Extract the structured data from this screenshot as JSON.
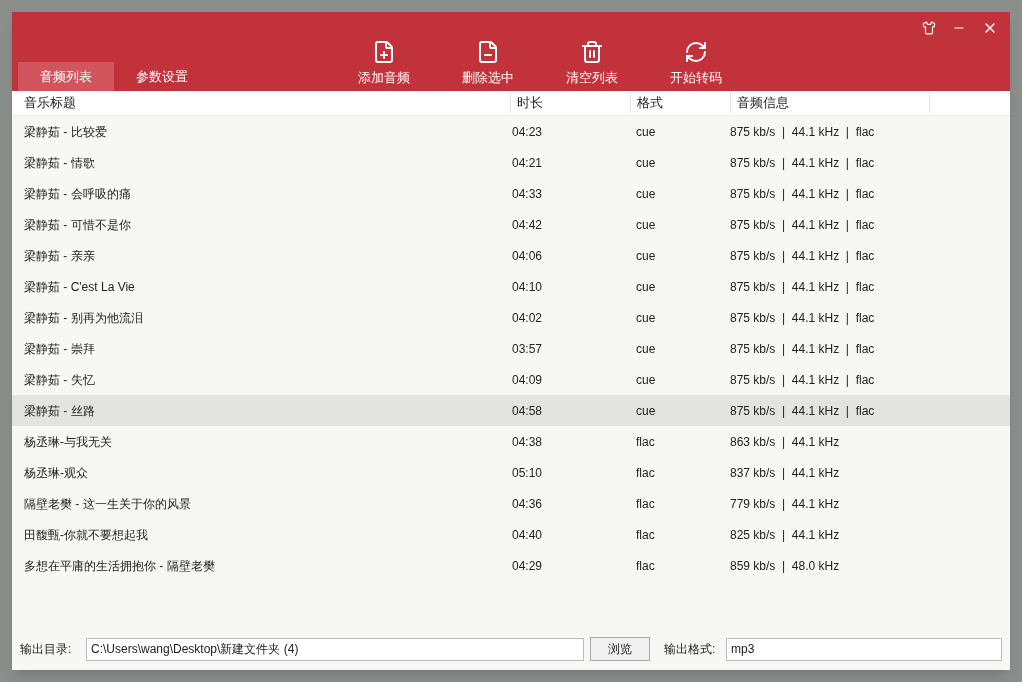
{
  "tabs": [
    {
      "label": "音频列表",
      "selected": true
    },
    {
      "label": "参数设置",
      "selected": false
    }
  ],
  "toolbar": [
    {
      "kind": "add",
      "label": "添加音频"
    },
    {
      "kind": "remove",
      "label": "删除选中"
    },
    {
      "kind": "clear",
      "label": "清空列表"
    },
    {
      "kind": "convert",
      "label": "开始转码"
    }
  ],
  "table": {
    "columns": [
      "音乐标题",
      "时长",
      "格式",
      "音频信息"
    ],
    "rows": [
      {
        "title": "梁静茹 - 比较爱",
        "duration": "04:23",
        "format": "cue",
        "info": "875 kb/s  |  44.1 kHz  |  flac",
        "selected": false
      },
      {
        "title": "梁静茹 - 情歌",
        "duration": "04:21",
        "format": "cue",
        "info": "875 kb/s  |  44.1 kHz  |  flac",
        "selected": false
      },
      {
        "title": "梁静茹 - 会呼吸的痛",
        "duration": "04:33",
        "format": "cue",
        "info": "875 kb/s  |  44.1 kHz  |  flac",
        "selected": false
      },
      {
        "title": "梁静茹 - 可惜不是你",
        "duration": "04:42",
        "format": "cue",
        "info": "875 kb/s  |  44.1 kHz  |  flac",
        "selected": false
      },
      {
        "title": "梁静茹 - 亲亲",
        "duration": "04:06",
        "format": "cue",
        "info": "875 kb/s  |  44.1 kHz  |  flac",
        "selected": false
      },
      {
        "title": "梁静茹 - C'est La Vie",
        "duration": "04:10",
        "format": "cue",
        "info": "875 kb/s  |  44.1 kHz  |  flac",
        "selected": false
      },
      {
        "title": "梁静茹 - 别再为他流泪",
        "duration": "04:02",
        "format": "cue",
        "info": "875 kb/s  |  44.1 kHz  |  flac",
        "selected": false
      },
      {
        "title": "梁静茹 - 崇拜",
        "duration": "03:57",
        "format": "cue",
        "info": "875 kb/s  |  44.1 kHz  |  flac",
        "selected": false
      },
      {
        "title": "梁静茹 - 失忆",
        "duration": "04:09",
        "format": "cue",
        "info": "875 kb/s  |  44.1 kHz  |  flac",
        "selected": false
      },
      {
        "title": "梁静茹 - 丝路",
        "duration": "04:58",
        "format": "cue",
        "info": "875 kb/s  |  44.1 kHz  |  flac",
        "selected": true
      },
      {
        "title": "杨丞琳-与我无关",
        "duration": "04:38",
        "format": "flac",
        "info": "863 kb/s  |  44.1 kHz",
        "selected": false
      },
      {
        "title": "杨丞琳-观众",
        "duration": "05:10",
        "format": "flac",
        "info": "837 kb/s  |  44.1 kHz",
        "selected": false
      },
      {
        "title": "隔壁老樊 - 这一生关于你的风景",
        "duration": "04:36",
        "format": "flac",
        "info": "779 kb/s  |  44.1 kHz",
        "selected": false
      },
      {
        "title": "田馥甄-你就不要想起我",
        "duration": "04:40",
        "format": "flac",
        "info": "825 kb/s  |  44.1 kHz",
        "selected": false
      },
      {
        "title": "多想在平庸的生活拥抱你 - 隔壁老樊",
        "duration": "04:29",
        "format": "flac",
        "info": "859 kb/s  |  48.0 kHz",
        "selected": false
      }
    ]
  },
  "footer": {
    "dir_label": "输出目录:",
    "dir_value": "C:\\Users\\wang\\Desktop\\新建文件夹 (4)",
    "browse": "浏览",
    "format_label": "输出格式:",
    "format_value": "mp3"
  }
}
